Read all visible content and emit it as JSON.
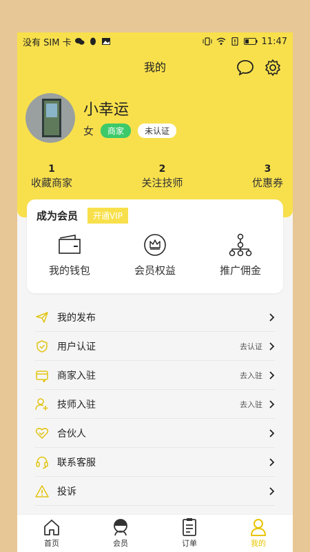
{
  "status_bar": {
    "carrier": "没有 SIM 卡",
    "time": "11:47"
  },
  "header": {
    "title": "我的"
  },
  "profile": {
    "name": "小幸运",
    "gender": "女",
    "badge_merchant": "商家",
    "badge_status": "未认证"
  },
  "stats": [
    {
      "count": "1",
      "label": "收藏商家"
    },
    {
      "count": "2",
      "label": "关注技师"
    },
    {
      "count": "3",
      "label": "优惠券"
    }
  ],
  "vip_card": {
    "title": "成为会员",
    "button": "开通VIP",
    "items": [
      {
        "label": "我的钱包",
        "icon": "wallet-icon"
      },
      {
        "label": "会员权益",
        "icon": "crown-icon"
      },
      {
        "label": "推广佣金",
        "icon": "network-icon"
      }
    ]
  },
  "menu": [
    {
      "label": "我的发布",
      "value": "",
      "icon": "send-icon"
    },
    {
      "label": "用户认证",
      "value": "去认证",
      "icon": "shield-icon"
    },
    {
      "label": "商家入驻",
      "value": "去入驻",
      "icon": "store-icon"
    },
    {
      "label": "技师入驻",
      "value": "去入驻",
      "icon": "user-add-icon"
    },
    {
      "label": "合伙人",
      "value": "",
      "icon": "handshake-icon"
    },
    {
      "label": "联系客服",
      "value": "",
      "icon": "headset-icon"
    },
    {
      "label": "投诉",
      "value": "",
      "icon": "warning-icon"
    }
  ],
  "tabs": [
    {
      "label": "首页"
    },
    {
      "label": "会员"
    },
    {
      "label": "订单"
    },
    {
      "label": "我的"
    }
  ],
  "colors": {
    "accent": "#f8e04c",
    "accent_text": "#e8c400",
    "merchant_badge": "#3cc96a",
    "page_bg": "#e8c796"
  }
}
